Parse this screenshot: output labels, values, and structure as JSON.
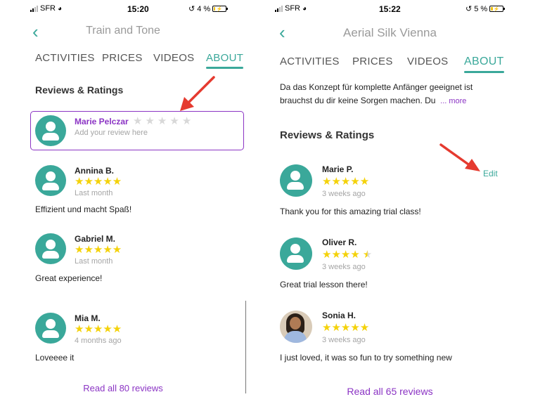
{
  "left": {
    "status": {
      "carrier": "SFR",
      "time": "15:20",
      "battery": "4 %"
    },
    "header": {
      "title": "Train and Tone"
    },
    "tabs": [
      "ACTIVITIES",
      "PRICES",
      "VIDEOS",
      "ABOUT"
    ],
    "active_tab": "ABOUT",
    "section_title": "Reviews & Ratings",
    "my_review": {
      "name": "Marie Pelczar",
      "placeholder": "Add your review here",
      "stars": 0
    },
    "reviews": [
      {
        "name": "Annina B.",
        "stars": 5,
        "when": "Last month",
        "text": "Effizient und macht Spaß!"
      },
      {
        "name": "Gabriel M.",
        "stars": 5,
        "when": "Last month",
        "text": "Great experience!"
      },
      {
        "name": "Mia M.",
        "stars": 5,
        "when": "4 months ago",
        "text": "Loveeee it"
      }
    ],
    "read_all": "Read all 80 reviews"
  },
  "right": {
    "status": {
      "carrier": "SFR",
      "time": "15:22",
      "battery": "5 %"
    },
    "header": {
      "title": "Aerial Silk Vienna"
    },
    "tabs": [
      "ACTIVITIES",
      "PRICES",
      "VIDEOS",
      "ABOUT"
    ],
    "active_tab": "ABOUT",
    "about": {
      "line1": "Da das Konzept für komplette Anfänger geeignet ist",
      "line2": "brauchst du dir keine Sorgen machen. Du",
      "more": "... more"
    },
    "section_title": "Reviews & Ratings",
    "edit_label": "Edit",
    "reviews": [
      {
        "name": "Marie P.",
        "stars": 5,
        "when": "3 weeks ago",
        "text": "Thank you for this amazing trial class!"
      },
      {
        "name": "Oliver R.",
        "stars": 4.5,
        "when": "3 weeks ago",
        "text": "Great trial lesson there!"
      },
      {
        "name": "Sonia H.",
        "stars": 5,
        "when": "3 weeks ago",
        "text": "I just loved, it was so fun to try something new"
      }
    ],
    "read_all": "Read all 65 reviews"
  },
  "icons": {
    "back": "chevron-left-icon",
    "avatar": "user-icon",
    "annotation": "red-arrow-icon"
  },
  "colors": {
    "accent": "#3aa89a",
    "purple": "#8b34c4",
    "star": "#f4d20a",
    "arrow": "#e53a2f"
  }
}
